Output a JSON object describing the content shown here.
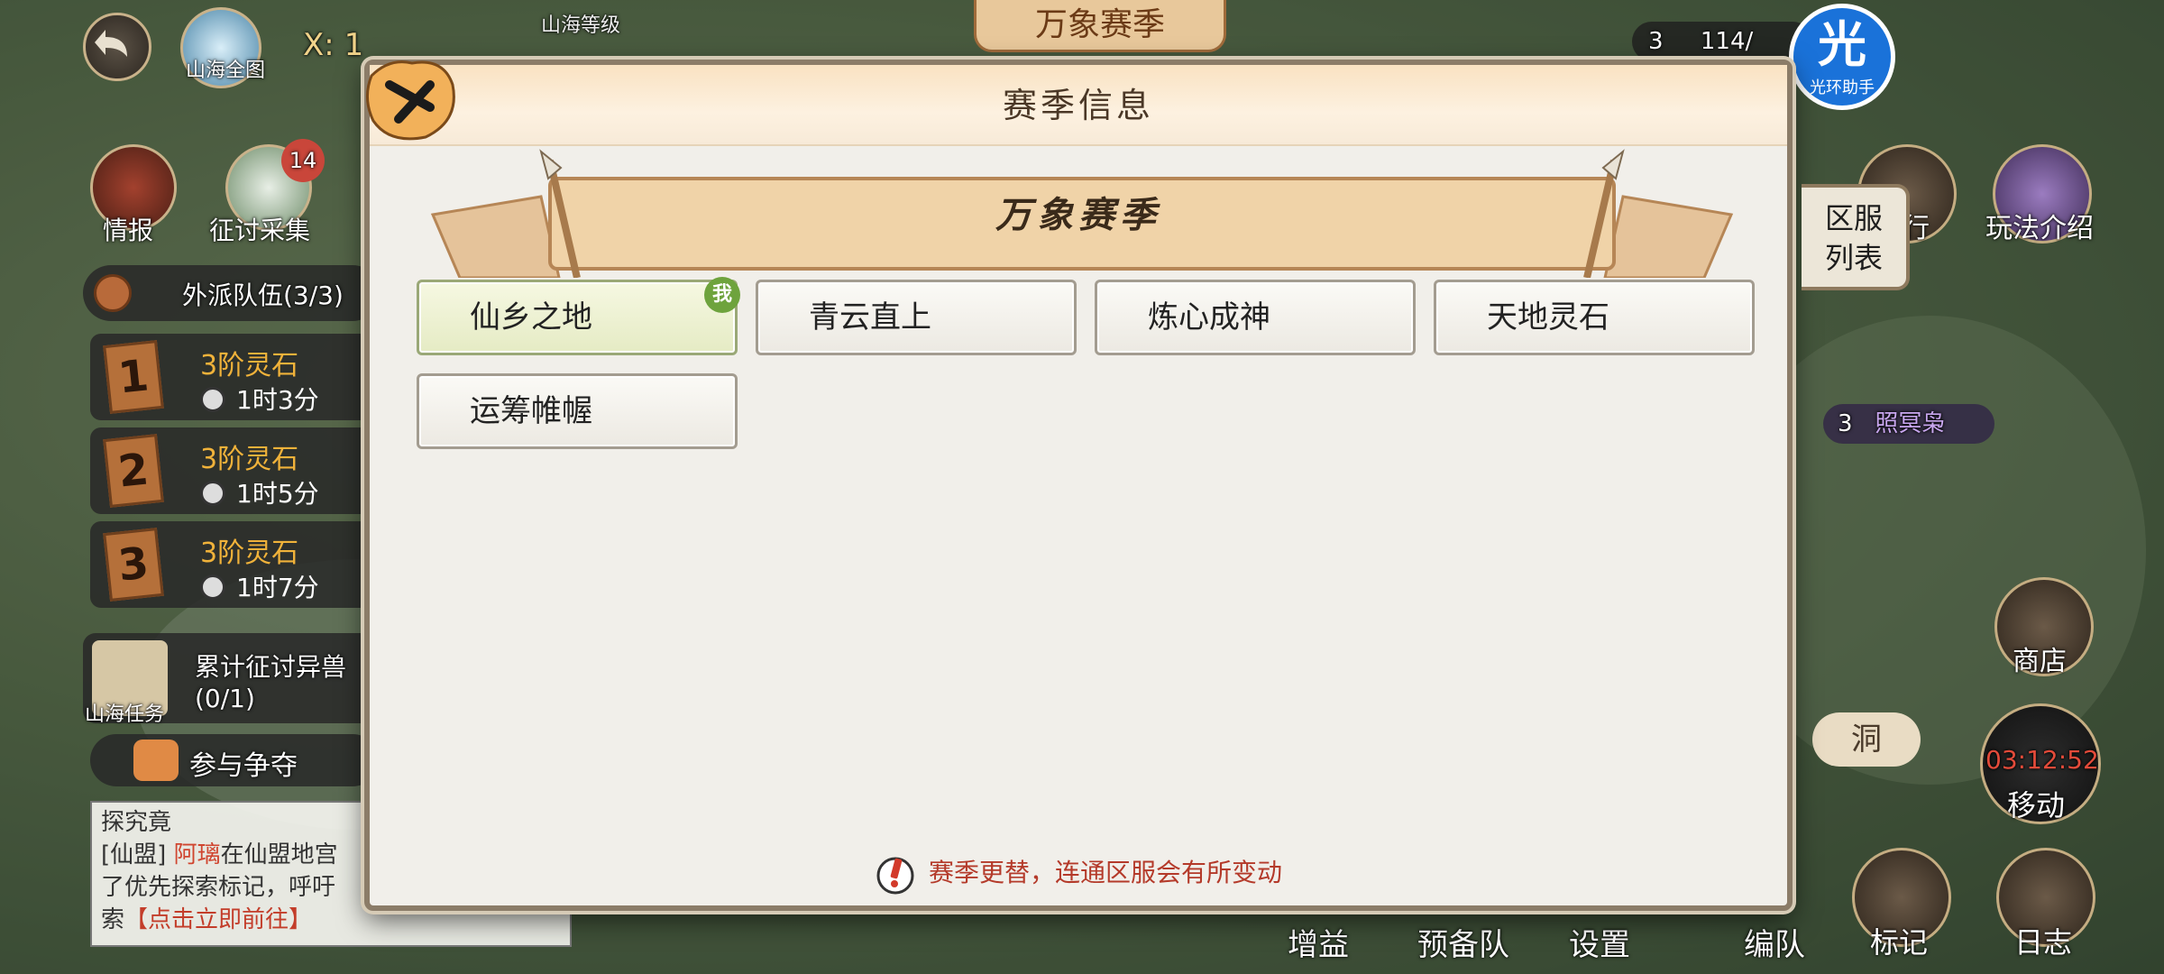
{
  "top_banner": "万象赛季",
  "left_hud": {
    "map_label": "山海全图",
    "coord_prefix": "X:",
    "coord_value": "1",
    "level_label": "山海等级",
    "intel_label": "情报",
    "expedition_label": "征讨采集",
    "expedition_badge": "14",
    "team_header": "外派队伍(3/3)",
    "teams": [
      {
        "flag": "1",
        "resource": "3阶灵石",
        "time": "1时3分"
      },
      {
        "flag": "2",
        "resource": "3阶灵石",
        "time": "1时5分"
      },
      {
        "flag": "3",
        "resource": "3阶灵石",
        "time": "1时7分"
      }
    ],
    "task_text": "累计征讨异兽",
    "task_progress": "(0/1)",
    "task_label": "山海任务",
    "join_label": "参与争夺"
  },
  "chat": {
    "tab": "探究竟",
    "line1_prefix": "[仙盟] ",
    "line1_name": "阿璃",
    "line1_text": "在仙盟地宫",
    "line2": "了优先探索标记，呼吁",
    "line3_prefix": "索",
    "line3_link": "【点击立即前往】"
  },
  "right_hud": {
    "top_count": "3",
    "top_value": "114/",
    "rank_label": "排行",
    "guide_label": "玩法介绍",
    "monster_level": "3",
    "monster_name": "照冥枭",
    "shop_label": "商店",
    "timer": "03:12:52",
    "move_label": "移动",
    "cave_label": "洞",
    "mark_label": "标记",
    "log_label": "日志"
  },
  "bottom_bar": [
    "增益",
    "预备队",
    "设置",
    "编队"
  ],
  "helper": {
    "glyph": "光",
    "label": "光环助手"
  },
  "modal": {
    "title": "赛季信息",
    "season_name": "万象赛季",
    "side_tab_line1": "区服",
    "side_tab_line2": "列表",
    "me_badge": "我",
    "servers": [
      "仙乡之地",
      "青云直上",
      "炼心成神",
      "天地灵石",
      "运筹帷幄"
    ],
    "notice": "赛季更替，连通区服会有所变动"
  }
}
